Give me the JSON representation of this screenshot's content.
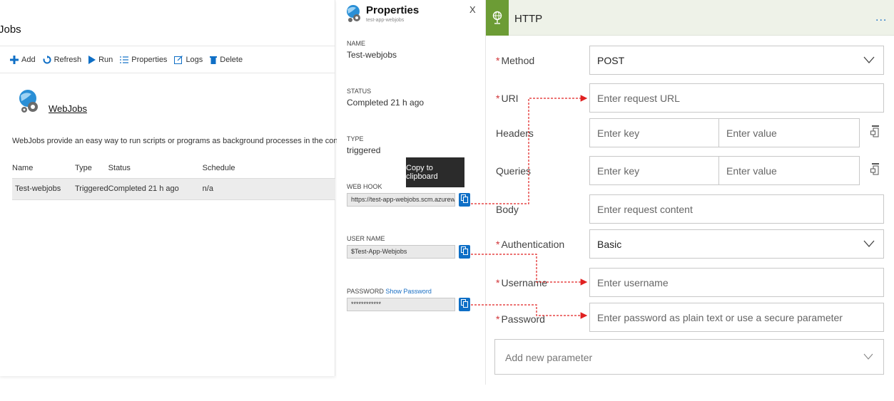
{
  "left": {
    "title": "Jobs",
    "toolbar": {
      "add": "Add",
      "refresh": "Refresh",
      "run": "Run",
      "properties": "Properties",
      "logs": "Logs",
      "delete": "Delete"
    },
    "heading": "WebJobs",
    "description": "WebJobs provide an easy way to run scripts or programs as background processes in the context of your app.",
    "table": {
      "headers": [
        "Name",
        "Type",
        "Status",
        "Schedule"
      ],
      "rows": [
        [
          "Test-webjobs",
          "Triggered",
          "Completed 21 h ago",
          "n/a"
        ]
      ]
    }
  },
  "properties": {
    "title": "Properties",
    "subtitle": "test-app-webjobs",
    "close": "X",
    "name_label": "NAME",
    "name_value": "Test-webjobs",
    "status_label": "STATUS",
    "status_value": "Completed 21 h ago",
    "type_label": "TYPE",
    "type_value": "triggered",
    "webhook_label": "WEB HOOK",
    "webhook_value": "https://test-app-webjobs.scm.azureweb...",
    "username_label": "USER NAME",
    "username_value": "$Test-App-Webjobs",
    "password_label": "PASSWORD",
    "show_password": "Show Password",
    "password_value": "************",
    "tooltip": "Copy to clipboard"
  },
  "http": {
    "title": "HTTP",
    "more": "...",
    "method_label": "Method",
    "method_value": "POST",
    "uri_label": "URI",
    "uri_placeholder": "Enter request URL",
    "headers_label": "Headers",
    "queries_label": "Queries",
    "key_placeholder": "Enter key",
    "value_placeholder": "Enter value",
    "body_label": "Body",
    "body_placeholder": "Enter request content",
    "auth_label": "Authentication",
    "auth_value": "Basic",
    "username_label": "Username",
    "username_placeholder": "Enter username",
    "password_label": "Password",
    "password_placeholder": "Enter password as plain text or use a secure parameter",
    "add_param": "Add new parameter",
    "required_mark": "*"
  },
  "colors": {
    "accent_blue": "#0f6fc6",
    "http_green": "#6c9c35",
    "connector_red": "#e02020",
    "required_red": "#d13438"
  }
}
